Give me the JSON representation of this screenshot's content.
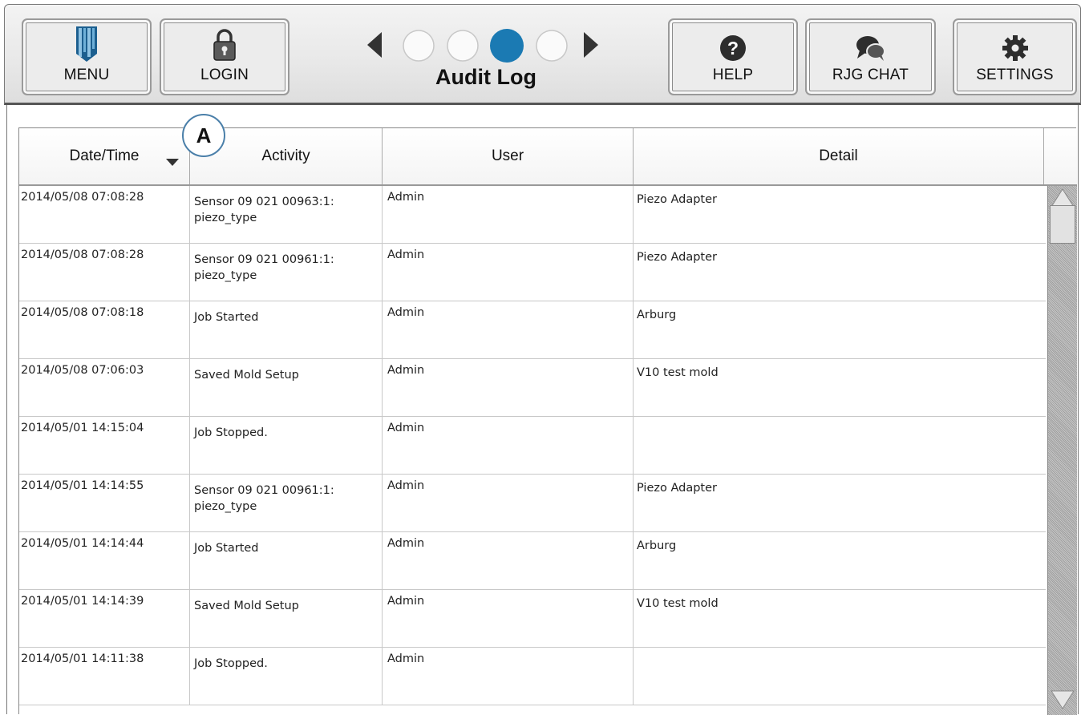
{
  "header": {
    "title": "Audit Log",
    "menu_label": "MENU",
    "login_label": "LOGIN",
    "help_label": "HELP",
    "chat_label": "RJG CHAT",
    "settings_label": "SETTINGS",
    "pager": {
      "page_count": 4,
      "active_page": 3
    },
    "accent_color": "#1b7ab3"
  },
  "annotation": {
    "label": "A"
  },
  "table": {
    "columns": [
      "Date/Time",
      "Activity",
      "User",
      "Detail"
    ],
    "sort": {
      "column": "Date/Time",
      "direction": "descending"
    },
    "rows": [
      {
        "date": "2014/05/08 07:08:28",
        "activity_line1": "Sensor 09 021 00963:1:",
        "activity_line2": "piezo_type",
        "user": "Admin",
        "detail": "Piezo Adapter"
      },
      {
        "date": "2014/05/08 07:08:28",
        "activity_line1": "Sensor 09 021 00961:1:",
        "activity_line2": "piezo_type",
        "user": "Admin",
        "detail": "Piezo Adapter"
      },
      {
        "date": "2014/05/08 07:08:18",
        "activity_line1": "Job Started",
        "activity_line2": "",
        "user": "Admin",
        "detail": "Arburg"
      },
      {
        "date": "2014/05/08 07:06:03",
        "activity_line1": "Saved Mold Setup",
        "activity_line2": "",
        "user": "Admin",
        "detail": "V10 test mold"
      },
      {
        "date": "2014/05/01 14:15:04",
        "activity_line1": "Job Stopped.",
        "activity_line2": "",
        "user": "Admin",
        "detail": ""
      },
      {
        "date": "2014/05/01 14:14:55",
        "activity_line1": "Sensor 09 021 00961:1:",
        "activity_line2": "piezo_type",
        "user": "Admin",
        "detail": "Piezo Adapter"
      },
      {
        "date": "2014/05/01 14:14:44",
        "activity_line1": "Job Started",
        "activity_line2": "",
        "user": "Admin",
        "detail": "Arburg"
      },
      {
        "date": "2014/05/01 14:14:39",
        "activity_line1": "Saved Mold Setup",
        "activity_line2": "",
        "user": "Admin",
        "detail": "V10 test mold"
      },
      {
        "date": "2014/05/01 14:11:38",
        "activity_line1": "Job Stopped.",
        "activity_line2": "",
        "user": "Admin",
        "detail": ""
      }
    ]
  }
}
